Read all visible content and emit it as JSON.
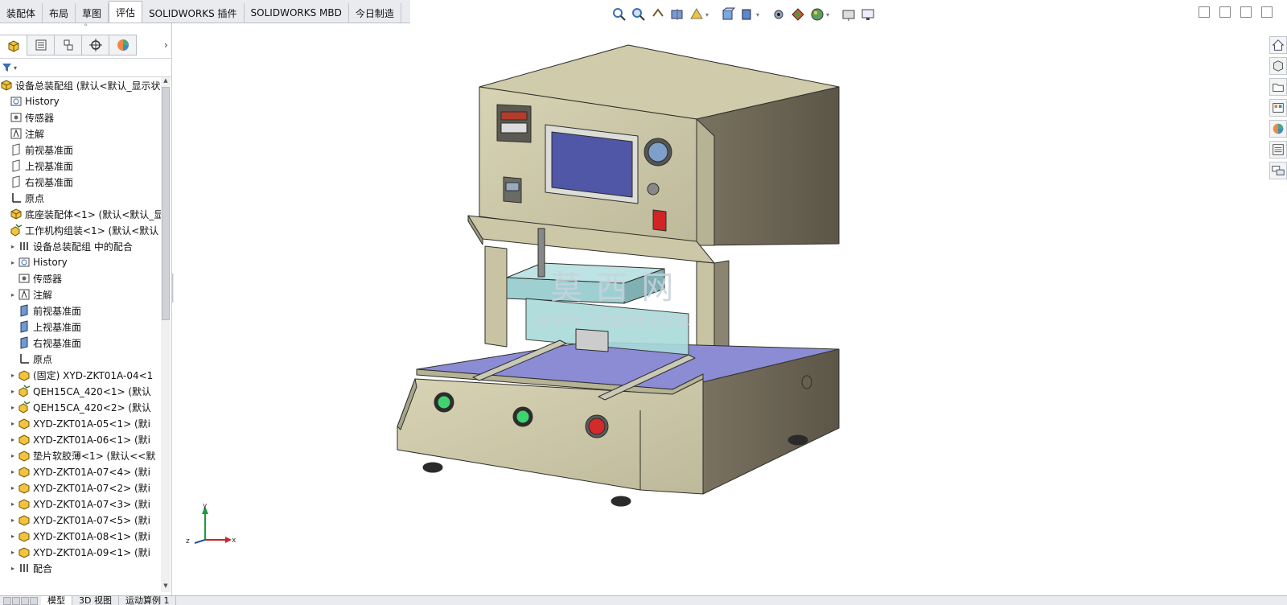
{
  "tabs": [
    {
      "label": "装配体",
      "active": false
    },
    {
      "label": "布局",
      "active": false
    },
    {
      "label": "草图",
      "active": false
    },
    {
      "label": "评估",
      "active": true
    },
    {
      "label": "SOLIDWORKS 插件",
      "active": false
    },
    {
      "label": "SOLIDWORKS MBD",
      "active": false
    },
    {
      "label": "今日制造",
      "active": false
    }
  ],
  "hud_icons": [
    "zoom-to-fit-icon",
    "zoom-area-icon",
    "previous-view-icon",
    "section-view-icon",
    "dynamic-annotation-icon",
    "view-orientation-icon",
    "display-style-icon",
    "hide-show-icon",
    "edit-appearance-icon",
    "apply-scene-icon",
    "view-settings-icon",
    "display-icon"
  ],
  "panel_tabs": [
    "featuremanager-tab-icon",
    "propertymanager-tab-icon",
    "configurationmanager-tab-icon",
    "dimxpert-tab-icon",
    "display-manager-tab-icon"
  ],
  "tree": [
    {
      "label": "设备总装配组  (默认<默认_显示状",
      "indent": 0,
      "expand": "",
      "icon": "assembly"
    },
    {
      "label": "History",
      "indent": 1,
      "expand": "",
      "icon": "history"
    },
    {
      "label": "传感器",
      "indent": 1,
      "expand": "",
      "icon": "sensor"
    },
    {
      "label": "注解",
      "indent": 1,
      "expand": "",
      "icon": "annotation"
    },
    {
      "label": "前视基准面",
      "indent": 1,
      "expand": "",
      "icon": "plane"
    },
    {
      "label": "上视基准面",
      "indent": 1,
      "expand": "",
      "icon": "plane"
    },
    {
      "label": "右视基准面",
      "indent": 1,
      "expand": "",
      "icon": "plane"
    },
    {
      "label": "原点",
      "indent": 1,
      "expand": "",
      "icon": "origin"
    },
    {
      "label": "底座装配体<1> (默认<默认_显",
      "indent": 1,
      "expand": "",
      "icon": "assembly"
    },
    {
      "label": "工作机构组装<1> (默认<默认",
      "indent": 1,
      "expand": "",
      "icon": "subassembly"
    },
    {
      "label": "设备总装配组 中的配合",
      "indent": 2,
      "expand": "▸",
      "icon": "mates"
    },
    {
      "label": "History",
      "indent": 2,
      "expand": "▸",
      "icon": "history"
    },
    {
      "label": "传感器",
      "indent": 2,
      "expand": "",
      "icon": "sensor"
    },
    {
      "label": "注解",
      "indent": 2,
      "expand": "▸",
      "icon": "annotation"
    },
    {
      "label": "前视基准面",
      "indent": 2,
      "expand": "",
      "icon": "plane-blue"
    },
    {
      "label": "上视基准面",
      "indent": 2,
      "expand": "",
      "icon": "plane-blue"
    },
    {
      "label": "右视基准面",
      "indent": 2,
      "expand": "",
      "icon": "plane-blue"
    },
    {
      "label": "原点",
      "indent": 2,
      "expand": "",
      "icon": "origin"
    },
    {
      "label": "(固定) XYD-ZKT01A-04<1",
      "indent": 2,
      "expand": "▸",
      "icon": "part"
    },
    {
      "label": "QEH15CA_420<1> (默认",
      "indent": 2,
      "expand": "▸",
      "icon": "subassembly"
    },
    {
      "label": "QEH15CA_420<2> (默认",
      "indent": 2,
      "expand": "▸",
      "icon": "subassembly"
    },
    {
      "label": "XYD-ZKT01A-05<1> (默i",
      "indent": 2,
      "expand": "▸",
      "icon": "part"
    },
    {
      "label": "XYD-ZKT01A-06<1> (默i",
      "indent": 2,
      "expand": "▸",
      "icon": "part"
    },
    {
      "label": "垫片软胶薄<1> (默认<<默",
      "indent": 2,
      "expand": "▸",
      "icon": "part"
    },
    {
      "label": "XYD-ZKT01A-07<4> (默i",
      "indent": 2,
      "expand": "▸",
      "icon": "part"
    },
    {
      "label": "XYD-ZKT01A-07<2> (默i",
      "indent": 2,
      "expand": "▸",
      "icon": "part"
    },
    {
      "label": "XYD-ZKT01A-07<3> (默i",
      "indent": 2,
      "expand": "▸",
      "icon": "part"
    },
    {
      "label": "XYD-ZKT01A-07<5> (默i",
      "indent": 2,
      "expand": "▸",
      "icon": "part"
    },
    {
      "label": "XYD-ZKT01A-08<1> (默i",
      "indent": 2,
      "expand": "▸",
      "icon": "part"
    },
    {
      "label": "XYD-ZKT01A-09<1> (默i",
      "indent": 2,
      "expand": "▸",
      "icon": "part"
    },
    {
      "label": "配合",
      "indent": 2,
      "expand": "▸",
      "icon": "mates"
    }
  ],
  "bottom_tabs": [
    {
      "label": "模型",
      "active": true
    },
    {
      "label": "3D 视图",
      "active": false
    },
    {
      "label": "运动算例 1",
      "active": false
    }
  ],
  "task_pane_icons": [
    "home-icon",
    "design-library-icon",
    "file-explorer-icon",
    "view-palette-icon",
    "appearances-icon",
    "custom-properties-icon",
    "forum-icon"
  ],
  "triad": {
    "x": "x",
    "y": "y",
    "z": "z"
  },
  "watermark": {
    "title": "莫 西 网",
    "url": "www.3dmox.com"
  },
  "colors": {
    "machine_body": "#c9c5a5",
    "machine_side": "#6e6656",
    "table": "#8f8fd8",
    "clamp": "#9ed0d2",
    "green_button": "#3fd36f",
    "estop": "#d42a2a"
  }
}
